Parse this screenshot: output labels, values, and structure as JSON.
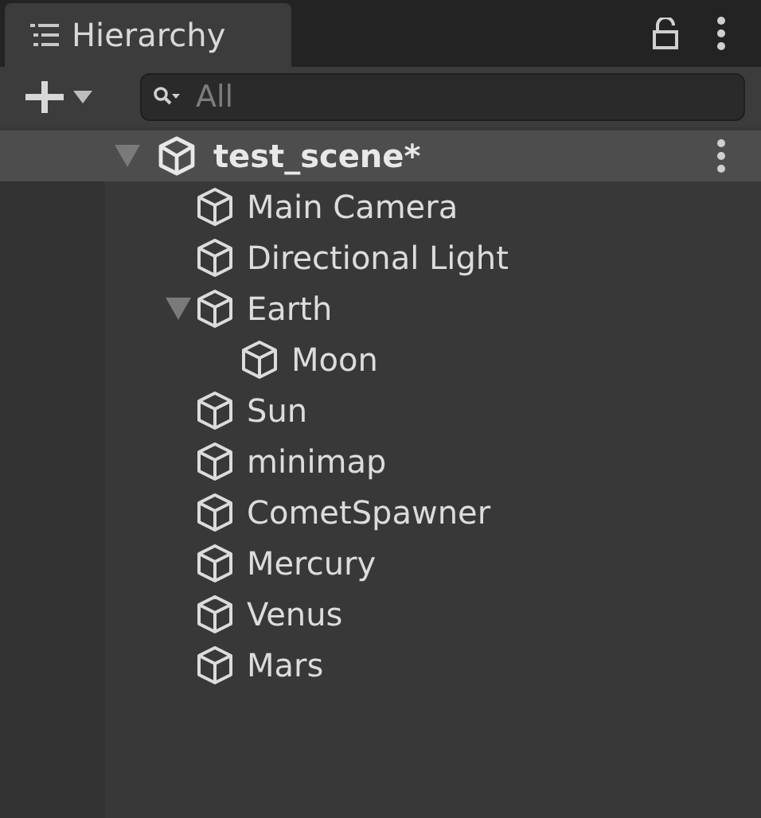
{
  "window": {
    "title": "Hierarchy"
  },
  "search": {
    "placeholder": "All"
  },
  "scene": {
    "name": "test_scene*",
    "expanded": true,
    "children": [
      {
        "name": "Main Camera"
      },
      {
        "name": "Directional Light"
      },
      {
        "name": "Earth",
        "expanded": true,
        "children": [
          {
            "name": "Moon"
          }
        ]
      },
      {
        "name": "Sun"
      },
      {
        "name": "minimap"
      },
      {
        "name": "CometSpawner"
      },
      {
        "name": "Mercury"
      },
      {
        "name": "Venus"
      },
      {
        "name": "Mars"
      }
    ]
  }
}
